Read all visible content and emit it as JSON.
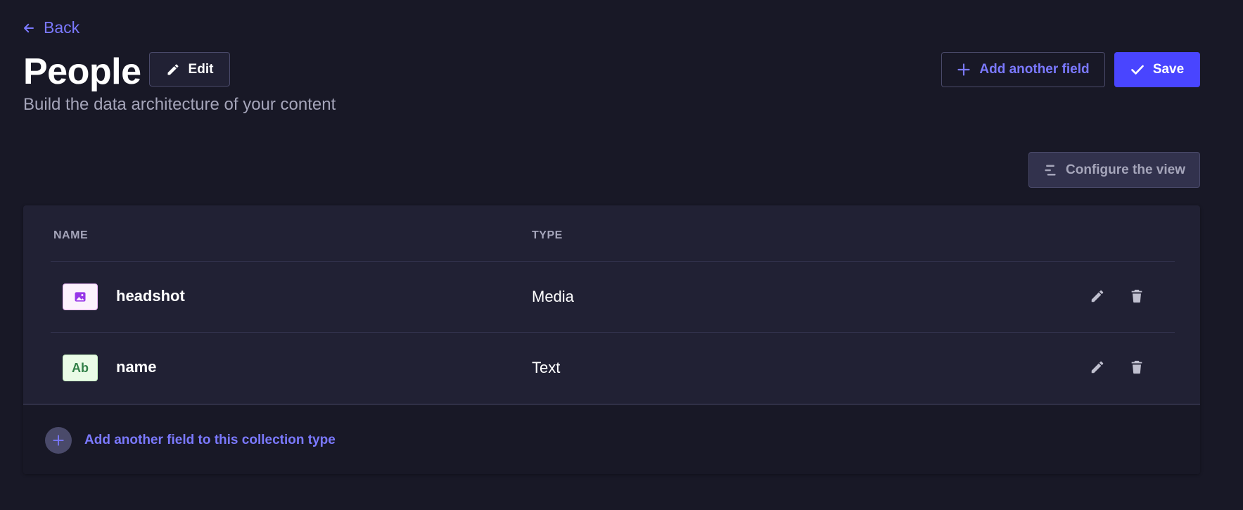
{
  "nav": {
    "back_label": "Back"
  },
  "header": {
    "title": "People",
    "edit_label": "Edit",
    "subtitle": "Build the data architecture of your content",
    "add_field_label": "Add another field",
    "save_label": "Save"
  },
  "toolbar": {
    "configure_label": "Configure the view"
  },
  "table": {
    "columns": [
      "NAME",
      "TYPE"
    ],
    "rows": [
      {
        "name": "headshot",
        "type": "Media",
        "icon": "media-icon"
      },
      {
        "name": "name",
        "type": "Text",
        "icon": "text-icon",
        "icon_text": "Ab"
      }
    ]
  },
  "footer": {
    "add_label": "Add another field to this collection type"
  },
  "colors": {
    "background": "#181826",
    "card": "#212134",
    "primary": "#4945ff",
    "accent_text": "#7b79ff",
    "muted_text": "#a5a5ba",
    "border": "#4a4a6a",
    "media_icon_bg": "#fcf2fd",
    "media_icon_fg": "#9736e8",
    "text_icon_bg": "#eafbe7",
    "text_icon_fg": "#328048"
  }
}
